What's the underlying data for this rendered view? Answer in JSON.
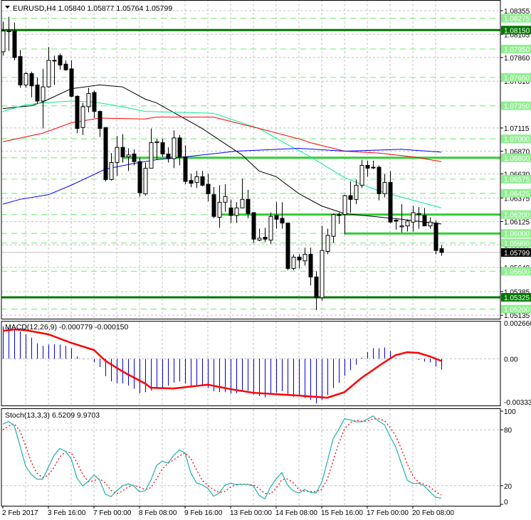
{
  "header": {
    "symbol_label": "EURUSD,H4 1.05840 1.05877 1.05764 1.05799"
  },
  "macd_header": "MACD(12,26,9) -0.000779 -0.000150",
  "stoch_header": "Stoch(13,3,3) 6.5209 9.9703",
  "colors": {
    "bull": "#ffffff",
    "bear": "#000000",
    "grid": "#c0c0c0",
    "level_dark": "#007800",
    "level_bright": "#32cd32",
    "level_light": "#90ee90",
    "ma_fast": "#000000",
    "ma_mid": "#00ee90",
    "ma_slow": "#ff0000",
    "ma_long": "#0000ff",
    "macd_hist": "#0000dd",
    "macd_signal": "#ff0000",
    "stoch_main": "#20b2aa",
    "stoch_signal": "#ff0000"
  },
  "chart_data": {
    "type": "candlestick",
    "title": "EURUSD,H4",
    "ylim": [
      1.05099,
      1.08468
    ],
    "ohlc_fields": [
      "open",
      "high",
      "low",
      "close"
    ],
    "candles": [
      [
        1.0792,
        1.0824,
        1.0788,
        1.0814
      ],
      [
        1.0814,
        1.0829,
        1.0793,
        1.0814
      ],
      [
        1.0814,
        1.0823,
        1.0783,
        1.0786
      ],
      [
        1.0787,
        1.0794,
        1.0754,
        1.0757
      ],
      [
        1.0757,
        1.0771,
        1.0754,
        1.0769
      ],
      [
        1.0769,
        1.0771,
        1.0744,
        1.0756
      ],
      [
        1.0757,
        1.0765,
        1.0737,
        1.074
      ],
      [
        1.074,
        1.0774,
        1.0711,
        1.0755
      ],
      [
        1.0755,
        1.0797,
        1.0754,
        1.0783
      ],
      [
        1.0783,
        1.0788,
        1.0757,
        1.0783
      ],
      [
        1.0788,
        1.079,
        1.0773,
        1.0778
      ],
      [
        1.0779,
        1.0783,
        1.0772,
        1.0773
      ],
      [
        1.0774,
        1.0783,
        1.0744,
        1.0745
      ],
      [
        1.0745,
        1.0746,
        1.0706,
        1.0711
      ],
      [
        1.0712,
        1.0738,
        1.0704,
        1.0734
      ],
      [
        1.0734,
        1.0754,
        1.0728,
        1.0748
      ],
      [
        1.0749,
        1.0751,
        1.0722,
        1.0729
      ],
      [
        1.0729,
        1.073,
        1.0702,
        1.0711
      ],
      [
        1.0712,
        1.0712,
        1.0655,
        1.0657
      ],
      [
        1.0657,
        1.0685,
        1.0656,
        1.0675
      ],
      [
        1.0675,
        1.0703,
        1.0661,
        1.0691
      ],
      [
        1.0691,
        1.0705,
        1.0675,
        1.0681
      ],
      [
        1.0681,
        1.069,
        1.0666,
        1.0683
      ],
      [
        1.0684,
        1.0689,
        1.0672,
        1.0676
      ],
      [
        1.0676,
        1.068,
        1.0639,
        1.0643
      ],
      [
        1.0642,
        1.0675,
        1.064,
        1.0669
      ],
      [
        1.0669,
        1.0711,
        1.0669,
        1.0696
      ],
      [
        1.0696,
        1.07,
        1.0678,
        1.0697
      ],
      [
        1.0696,
        1.07,
        1.0681,
        1.0684
      ],
      [
        1.0684,
        1.0691,
        1.0675,
        1.0679
      ],
      [
        1.0679,
        1.0709,
        1.0669,
        1.0701
      ],
      [
        1.0701,
        1.0704,
        1.0672,
        1.0681
      ],
      [
        1.0681,
        1.0693,
        1.0652,
        1.0655
      ],
      [
        1.0656,
        1.0663,
        1.0649,
        1.0653
      ],
      [
        1.0654,
        1.0666,
        1.0648,
        1.066
      ],
      [
        1.066,
        1.0666,
        1.065,
        1.0651
      ],
      [
        1.0652,
        1.0663,
        1.0634,
        1.0642
      ],
      [
        1.0641,
        1.0649,
        1.0616,
        1.0618
      ],
      [
        1.0617,
        1.0651,
        1.0606,
        1.0633
      ],
      [
        1.0633,
        1.0652,
        1.0623,
        1.0639
      ],
      [
        1.0627,
        1.0636,
        1.0611,
        1.0619
      ],
      [
        1.0619,
        1.0633,
        1.0611,
        1.0627
      ],
      [
        1.0627,
        1.0658,
        1.0627,
        1.0636
      ],
      [
        1.0636,
        1.0646,
        1.0616,
        1.0621
      ],
      [
        1.0622,
        1.0622,
        1.059,
        1.0594
      ],
      [
        1.0593,
        1.0605,
        1.0592,
        1.0595
      ],
      [
        1.0596,
        1.0606,
        1.0591,
        1.0594
      ],
      [
        1.0593,
        1.0622,
        1.0589,
        1.0618
      ],
      [
        1.0619,
        1.0633,
        1.0605,
        1.0615
      ],
      [
        1.0616,
        1.0633,
        1.0605,
        1.0611
      ],
      [
        1.0611,
        1.0611,
        1.0561,
        1.0563
      ],
      [
        1.0563,
        1.0578,
        1.0561,
        1.0575
      ],
      [
        1.0575,
        1.0578,
        1.0563,
        1.0572
      ],
      [
        1.0571,
        1.0585,
        1.0566,
        1.0578
      ],
      [
        1.0578,
        1.0585,
        1.0545,
        1.0554
      ],
      [
        1.0554,
        1.056,
        1.0519,
        1.0532
      ],
      [
        1.0532,
        1.0608,
        1.0529,
        1.0582
      ],
      [
        1.0581,
        1.0605,
        1.0578,
        1.0598
      ],
      [
        1.0597,
        1.0621,
        1.059,
        1.062
      ],
      [
        1.062,
        1.0622,
        1.061,
        1.0619
      ],
      [
        1.062,
        1.0641,
        1.0599,
        1.064
      ],
      [
        1.064,
        1.0655,
        1.0622,
        1.0636
      ],
      [
        1.0636,
        1.0657,
        1.0631,
        1.0651
      ],
      [
        1.0651,
        1.0678,
        1.0648,
        1.0672
      ],
      [
        1.0672,
        1.0677,
        1.066,
        1.0669
      ],
      [
        1.067,
        1.0677,
        1.0668,
        1.067
      ],
      [
        1.067,
        1.0672,
        1.0635,
        1.0642
      ],
      [
        1.0642,
        1.0663,
        1.0638,
        1.0654
      ],
      [
        1.0654,
        1.0666,
        1.0611,
        1.0612
      ],
      [
        1.0614,
        1.0615,
        1.0604,
        1.0613
      ],
      [
        1.0607,
        1.0631,
        1.0601,
        1.0608
      ],
      [
        1.0608,
        1.0615,
        1.0602,
        1.0613
      ],
      [
        1.0612,
        1.0629,
        1.0602,
        1.0622
      ],
      [
        1.0621,
        1.0628,
        1.0605,
        1.062
      ],
      [
        1.0619,
        1.0627,
        1.0608,
        1.0608
      ],
      [
        1.0608,
        1.0617,
        1.0605,
        1.0612
      ],
      [
        1.0611,
        1.0614,
        1.0578,
        1.0582
      ],
      [
        1.0584,
        1.05877,
        1.05764,
        1.05799
      ]
    ],
    "moving_averages": [
      {
        "name": "ma_fast",
        "points": [
          [
            0,
            1.0732
          ],
          [
            5,
            1.0735
          ],
          [
            7,
            1.0739
          ],
          [
            12,
            1.0753
          ],
          [
            17,
            1.0757
          ],
          [
            21,
            1.0755
          ],
          [
            25,
            1.0742
          ],
          [
            27,
            1.0738
          ],
          [
            35,
            1.0711
          ],
          [
            38,
            1.0699
          ],
          [
            42,
            1.0683
          ],
          [
            45,
            1.0666
          ],
          [
            48,
            1.066
          ],
          [
            52,
            1.0642
          ],
          [
            56,
            1.0629
          ],
          [
            60,
            1.0621
          ],
          [
            65,
            1.0618
          ],
          [
            70,
            1.0615
          ],
          [
            77,
            1.061
          ]
        ]
      },
      {
        "name": "ma_mid",
        "points": [
          [
            0,
            1.0729
          ],
          [
            4,
            1.0736
          ],
          [
            7,
            1.0738
          ],
          [
            12,
            1.074
          ],
          [
            16,
            1.0739
          ],
          [
            20,
            1.0735
          ],
          [
            25,
            1.0729
          ],
          [
            37,
            1.0727
          ],
          [
            41,
            1.0719
          ],
          [
            45,
            1.0711
          ],
          [
            50,
            1.0694
          ],
          [
            54,
            1.0681
          ],
          [
            60,
            1.0659
          ],
          [
            66,
            1.0645
          ],
          [
            77,
            1.0627
          ]
        ]
      },
      {
        "name": "ma_slow",
        "points": [
          [
            0,
            1.0697
          ],
          [
            7,
            1.0706
          ],
          [
            12,
            1.0717
          ],
          [
            17,
            1.0722
          ],
          [
            25,
            1.0721
          ],
          [
            27,
            1.0723
          ],
          [
            37,
            1.0723
          ],
          [
            41,
            1.0717
          ],
          [
            45,
            1.0711
          ],
          [
            52,
            1.07
          ],
          [
            54,
            1.0696
          ],
          [
            60,
            1.0687
          ],
          [
            66,
            1.0685
          ],
          [
            72,
            1.0681
          ],
          [
            77,
            1.0676
          ]
        ]
      },
      {
        "name": "ma_long",
        "points": [
          [
            0,
            1.0631
          ],
          [
            3,
            1.0636
          ],
          [
            8,
            1.0641
          ],
          [
            12,
            1.0651
          ],
          [
            18,
            1.0668
          ],
          [
            23,
            1.0674
          ],
          [
            27,
            1.0678
          ],
          [
            32,
            1.0681
          ],
          [
            41,
            1.0687
          ],
          [
            52,
            1.069
          ],
          [
            60,
            1.0687
          ],
          [
            70,
            1.0689
          ],
          [
            77,
            1.0686
          ]
        ]
      }
    ],
    "levels_major": [
      {
        "price": 1.0815,
        "label": "1.08150"
      },
      {
        "price": 1.05325,
        "label": "1.05325"
      }
    ],
    "levels_segments": [
      {
        "price": 1.068,
        "from_bar": 21
      },
      {
        "price": 1.062,
        "from_bar": 38
      },
      {
        "price": 1.06,
        "from_bar": 60
      }
    ],
    "levels_minor": [
      {
        "price": 1.08275,
        "label": "1.08275"
      },
      {
        "price": 1.0795,
        "label": "1.07950"
      },
      {
        "price": 1.0765,
        "label": "1.07650"
      },
      {
        "price": 1.0735,
        "label": "1.07350"
      },
      {
        "price": 1.07,
        "label": "1.07000"
      },
      {
        "price": 1.068,
        "label": "1.06800"
      },
      {
        "price": 1.06575,
        "label": "1.06575"
      },
      {
        "price": 1.06425,
        "label": "1.06425"
      },
      {
        "price": 1.062,
        "label": "1.06200"
      },
      {
        "price": 1.06,
        "label": "1.06000"
      },
      {
        "price": 1.059,
        "label": "1.05900"
      },
      {
        "price": 1.056,
        "label": "1.05600"
      },
      {
        "price": 1.052,
        "label": "1.05200"
      }
    ],
    "current_price": {
      "price": 1.05799,
      "label": "1.05799"
    },
    "price_ticks": [
      "1.08355",
      "1.08105",
      "1.07860",
      "1.07610",
      "1.07115",
      "1.06870",
      "1.06630",
      "1.06375",
      "1.06125",
      "1.05880",
      "1.05640",
      "1.05385",
      "1.05135"
    ],
    "time_labels": [
      {
        "bar": 0,
        "label": "2 Feb 2017"
      },
      {
        "bar": 8,
        "label": "3 Feb 16:00"
      },
      {
        "bar": 16,
        "label": "7 Feb 00:00"
      },
      {
        "bar": 24,
        "label": "8 Feb 08:00"
      },
      {
        "bar": 32,
        "label": "9 Feb 16:00"
      },
      {
        "bar": 40,
        "label": "13 Feb 00:00"
      },
      {
        "bar": 48,
        "label": "14 Feb 08:00"
      },
      {
        "bar": 56,
        "label": "15 Feb 16:00"
      },
      {
        "bar": 64,
        "label": "17 Feb 00:00"
      },
      {
        "bar": 72,
        "label": "20 Feb 08:00"
      }
    ],
    "macd": {
      "ylim": [
        -0.003336,
        0.002666
      ],
      "ticks": [
        "0.002666",
        "0.00",
        "-0.003336"
      ],
      "histogram": [
        0.00232,
        0.00224,
        0.00215,
        0.00195,
        0.00176,
        0.00151,
        0.0011,
        0.00093,
        0.00102,
        0.00105,
        0.00102,
        0.00093,
        0.00075,
        0.00017,
        3e-05,
        -1e-05,
        -0.00025,
        -0.00059,
        -0.00124,
        -0.00161,
        -0.00175,
        -0.00175,
        -0.00192,
        -0.00214,
        -0.00248,
        -0.00239,
        -0.00226,
        -0.00212,
        -0.00204,
        -0.00192,
        -0.0017,
        -0.00161,
        -0.00178,
        -0.00192,
        -0.00187,
        -0.00187,
        -0.00209,
        -0.00232,
        -0.00238,
        -0.00238,
        -0.00249,
        -0.00246,
        -0.00229,
        -0.00229,
        -0.00255,
        -0.00266,
        -0.00275,
        -0.00255,
        -0.00243,
        -0.00232,
        -0.00255,
        -0.00271,
        -0.00266,
        -0.0028,
        -0.00294,
        -0.00319,
        -0.00294,
        -0.0026,
        -0.00209,
        -0.00173,
        -0.00122,
        -0.00081,
        -0.00042,
        7e-05,
        0.00048,
        0.00076,
        0.00076,
        0.00081,
        0.00056,
        5e-05,
        2e-05,
        0.0,
        -1e-05,
        -8e-05,
        -0.0002,
        -0.00025,
        -0.00056,
        -0.000779
      ],
      "signal_points": [
        [
          0,
          0.002
        ],
        [
          2,
          0.0021
        ],
        [
          4,
          0.00205
        ],
        [
          8,
          0.00175
        ],
        [
          12,
          0.00114
        ],
        [
          16,
          0.00063
        ],
        [
          18,
          -0.00014
        ],
        [
          21,
          -0.0009
        ],
        [
          25,
          -0.00177
        ],
        [
          26,
          -0.00207
        ],
        [
          30,
          -0.00212
        ],
        [
          36,
          -0.00185
        ],
        [
          40,
          -0.00217
        ],
        [
          44,
          -0.00243
        ],
        [
          48,
          -0.00253
        ],
        [
          52,
          -0.00263
        ],
        [
          57,
          -0.00278
        ],
        [
          60,
          -0.00238
        ],
        [
          63,
          -0.00136
        ],
        [
          67,
          -0.00024
        ],
        [
          69,
          0.00027
        ],
        [
          71,
          0.00047
        ],
        [
          73,
          0.00042
        ],
        [
          75,
          0.00017
        ],
        [
          77,
          -0.00015
        ]
      ]
    },
    "stochastic": {
      "ylim": [
        0,
        100
      ],
      "ticks": [
        "100",
        "80",
        "20",
        "0"
      ],
      "main": [
        86,
        89,
        84.5,
        63,
        41,
        32,
        27,
        27,
        40,
        52.6,
        60,
        57,
        49,
        28.5,
        19.7,
        24.8,
        31.6,
        26,
        10.9,
        8.3,
        14.6,
        19.7,
        22,
        19.7,
        13.4,
        14.6,
        26,
        41.8,
        46.3,
        44.3,
        52.6,
        58.5,
        55,
        34,
        23,
        21,
        17.2,
        8.8,
        12.1,
        20.5,
        22.8,
        21,
        21.5,
        21.5,
        19.7,
        9.6,
        5.8,
        18.5,
        27.3,
        34,
        20.5,
        14.6,
        12.1,
        16,
        12.9,
        12.1,
        23.5,
        46.3,
        70.3,
        80.5,
        91.9,
        90.6,
        88.5,
        88.5,
        91.3,
        94.9,
        89.3,
        85.5,
        72.9,
        61.5,
        43.7,
        26,
        22.2,
        22.8,
        19.7,
        13.4,
        7.6,
        6.5209
      ],
      "signal": [
        80,
        84,
        86.5,
        78.8,
        62.8,
        45.3,
        33.3,
        28.7,
        31.3,
        39.9,
        50.9,
        56.5,
        55.3,
        44.8,
        32.4,
        24.3,
        25.4,
        27.5,
        22.8,
        15.1,
        11.3,
        14.2,
        18.8,
        20.5,
        18.4,
        15.9,
        18,
        27.5,
        38,
        44.1,
        47.7,
        51.8,
        55.4,
        49.2,
        37.3,
        26,
        20.4,
        15.7,
        12.7,
        13.8,
        18.5,
        21.4,
        21.8,
        21.3,
        20.9,
        16.9,
        11.7,
        11.3,
        17.2,
        26.6,
        27.3,
        23,
        15.7,
        14.2,
        13.7,
        13.7,
        16.2,
        27.3,
        46.7,
        65.7,
        80.9,
        87.7,
        90.3,
        89.2,
        89.4,
        91.6,
        91.8,
        89.9,
        82.6,
        73.3,
        59.4,
        43.7,
        30.6,
        23.7,
        21.6,
        18.6,
        13.6,
        9.9703
      ]
    }
  }
}
